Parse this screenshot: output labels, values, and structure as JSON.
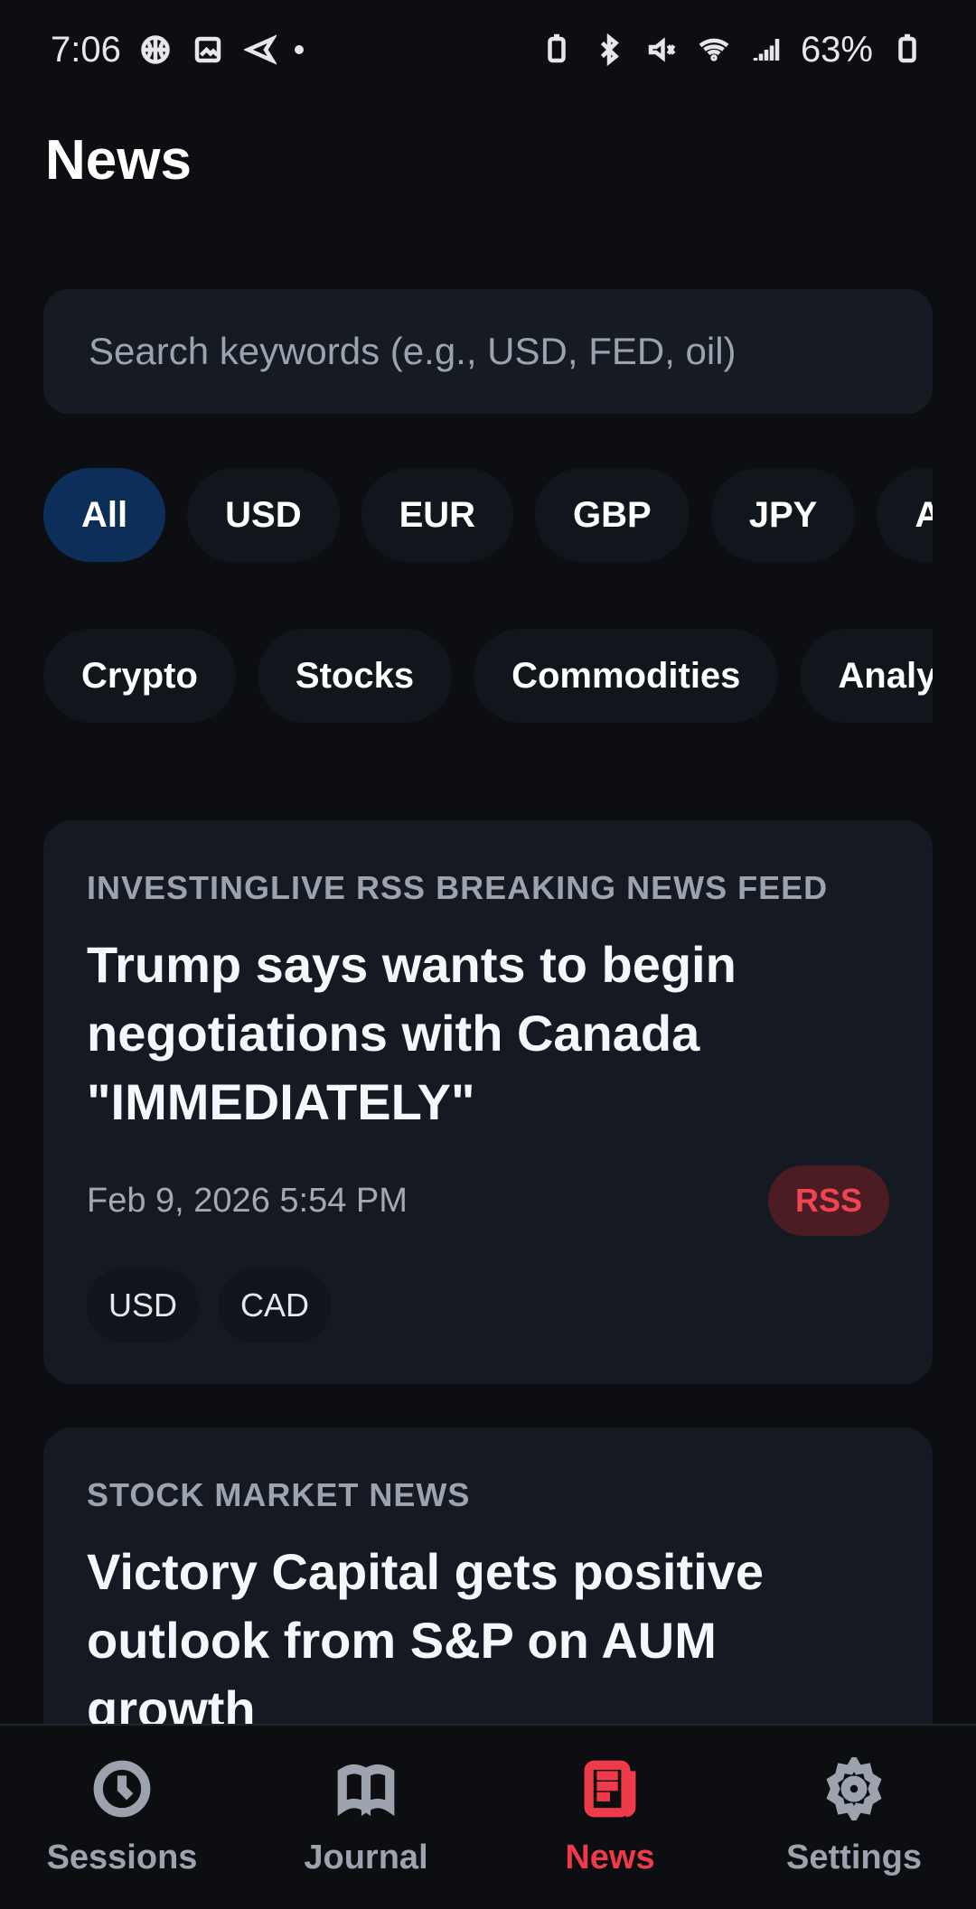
{
  "status_bar": {
    "time": "7:06",
    "battery": "63%",
    "icons": [
      "basketball-icon",
      "image-icon",
      "send-icon",
      "dot-icon",
      "battery-saver-icon",
      "bluetooth-icon",
      "mute-icon",
      "wifi-icon",
      "signal-icon",
      "battery-icon"
    ]
  },
  "header": {
    "title": "News"
  },
  "search": {
    "placeholder": "Search keywords (e.g., USD, FED, oil)"
  },
  "filters": {
    "currency_chips": [
      "All",
      "USD",
      "EUR",
      "GBP",
      "JPY",
      "AU"
    ],
    "category_chips": [
      "Crypto",
      "Stocks",
      "Commodities",
      "Analysi"
    ]
  },
  "news": [
    {
      "source": "INVESTINGLIVE RSS BREAKING NEWS FEED",
      "title": "Trump says wants to begin negotiations with Canada \"IMMEDIATELY\"",
      "date": "Feb 9, 2026 5:54 PM",
      "badge": "RSS",
      "tags": [
        "USD",
        "CAD"
      ]
    },
    {
      "source": "STOCK MARKET NEWS",
      "title": "Victory Capital gets positive outlook from S&P on AUM growth"
    }
  ],
  "bottom_nav": {
    "items": [
      {
        "label": "Sessions",
        "icon": "clock-icon"
      },
      {
        "label": "Journal",
        "icon": "book-icon"
      },
      {
        "label": "News",
        "icon": "newspaper-icon"
      },
      {
        "label": "Settings",
        "icon": "gear-icon"
      }
    ]
  },
  "colors": {
    "background": "#0c0e12",
    "card": "#151922",
    "accent": "#ef3b49",
    "active_chip": "#0c2e58"
  }
}
